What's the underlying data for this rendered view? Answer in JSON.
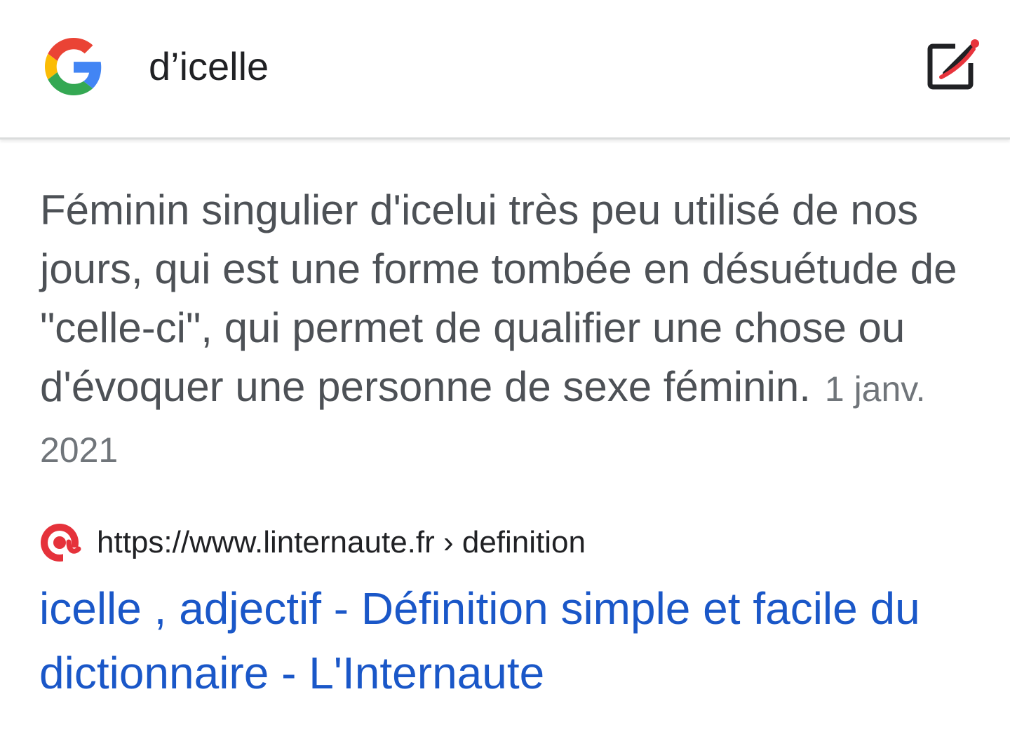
{
  "search_bar": {
    "query": "d’icelle",
    "logo_icon": "google-g-icon",
    "edit_icon": "edit-square-icon"
  },
  "snippet": {
    "text": "Féminin singulier d'icelui très peu utilisé de nos jours, qui est une forme tombée en désuétude de \"celle-ci\", qui permet de qualifier une chose ou d'évoquer une personne de sexe féminin.",
    "date": "1 janv. 2021"
  },
  "result": {
    "favicon_icon": "linternaute-at-icon",
    "url": "https://www.linternaute.fr › definition",
    "title": "icelle , adjectif - Définition simple et facile du dictionnaire - L'Internaute"
  },
  "colors": {
    "link": "#1a57c8",
    "snippet_text": "#4d5156",
    "favicon": "#e5323b",
    "google_blue": "#4285f4",
    "google_red": "#ea4335",
    "google_yellow": "#fbbc05",
    "google_green": "#34a853"
  }
}
